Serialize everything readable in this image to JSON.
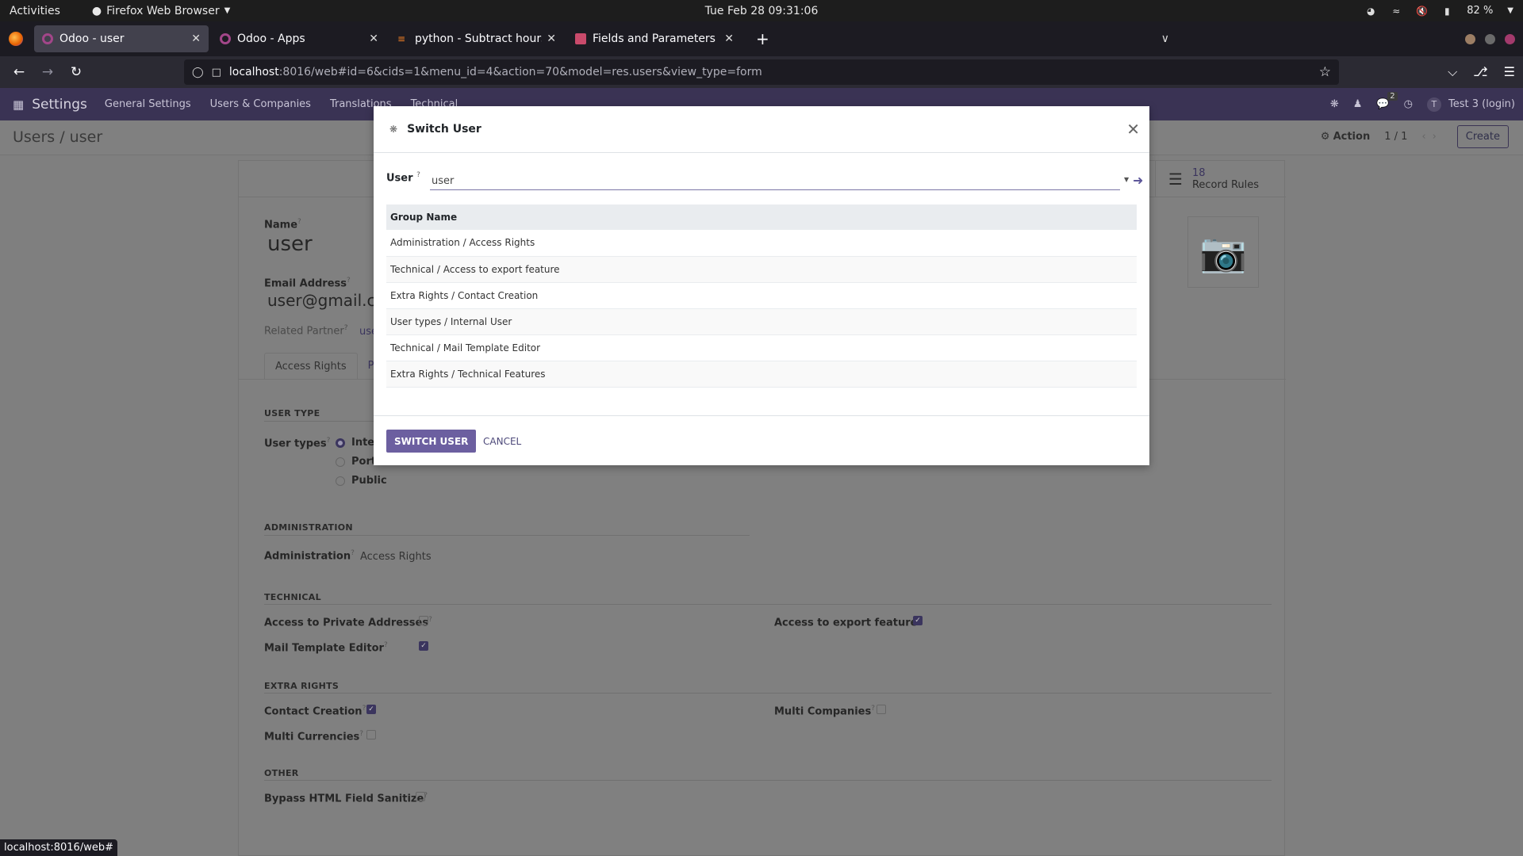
{
  "gnome": {
    "activities": "Activities",
    "app_name": "Firefox Web Browser",
    "clock": "Tue Feb 28  09:31:06",
    "battery": "82 %"
  },
  "browser": {
    "tabs": [
      {
        "title": "Odoo - user",
        "active": true
      },
      {
        "title": "Odoo - Apps",
        "active": false
      },
      {
        "title": "python - Subtract hours a",
        "active": false
      },
      {
        "title": "Fields and Parameters in",
        "active": false
      }
    ],
    "url_host": "localhost",
    "url_rest": ":8016/web#id=6&cids=1&menu_id=4&action=70&model=res.users&view_type=form",
    "status_link": "localhost:8016/web#"
  },
  "odoo_nav": {
    "brand": "Settings",
    "menu": [
      "General Settings",
      "Users & Companies",
      "Translations",
      "Technical"
    ],
    "message_count": "2",
    "user_initial": "T",
    "user_name": "Test 3 (login)"
  },
  "control_panel": {
    "breadcrumb": "Users / user",
    "action_label": "Action",
    "pager": "1 / 1",
    "create_label": "Create"
  },
  "form": {
    "stat_button": {
      "value": "18",
      "label": "Record Rules"
    },
    "name_label": "Name",
    "name_value": "user",
    "email_label": "Email Address",
    "email_value": "user@gmail.com",
    "partner_label": "Related Partner",
    "partner_value": "user",
    "tabs": [
      "Access Rights",
      "Preferences"
    ],
    "sections": {
      "user_type": "USER TYPE",
      "administration": "ADMINISTRATION",
      "technical": "TECHNICAL",
      "extra_rights": "EXTRA RIGHTS",
      "other": "OTHER"
    },
    "user_types_label": "User types",
    "user_types": [
      {
        "label": "Internal User",
        "selected": true
      },
      {
        "label": "Portal",
        "selected": false
      },
      {
        "label": "Public",
        "selected": false
      }
    ],
    "administration_label": "Administration",
    "administration_value": "Access Rights",
    "technical": [
      {
        "label": "Access to Private Addresses",
        "checked": false
      },
      {
        "label": "Mail Template Editor",
        "checked": true
      },
      {
        "label": "Access to export feature",
        "checked": true
      }
    ],
    "extra_rights": [
      {
        "label": "Contact Creation",
        "checked": true
      },
      {
        "label": "Multi Currencies",
        "checked": false
      },
      {
        "label": "Multi Companies",
        "checked": false
      }
    ],
    "other": [
      {
        "label": "Bypass HTML Field Sanitize",
        "checked": false
      }
    ]
  },
  "modal": {
    "title": "Switch User",
    "user_label": "User",
    "user_value": "user",
    "table_header": "Group Name",
    "groups": [
      "Administration / Access Rights",
      "Technical / Access to export feature",
      "Extra Rights / Contact Creation",
      "User types / Internal User",
      "Technical / Mail Template Editor",
      "Extra Rights / Technical Features"
    ],
    "switch_label": "SWITCH USER",
    "cancel_label": "CANCEL"
  }
}
